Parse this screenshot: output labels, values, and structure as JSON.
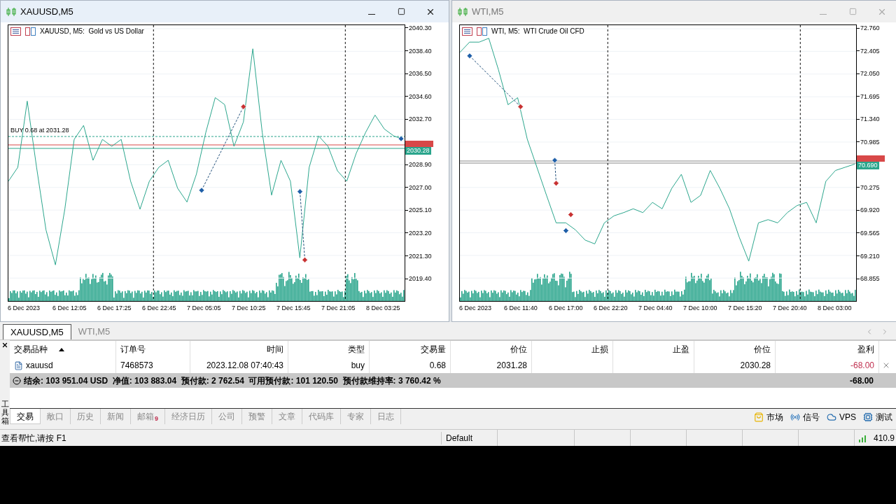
{
  "windows": [
    {
      "title": "XAUUSD,M5",
      "active": true,
      "legend": "XAUUSD, M5:  Gold vs US Dollar",
      "time_labels": [
        "6 Dec 2023",
        "6 Dec 12:05",
        "6 Dec 17:25",
        "6 Dec 22:45",
        "7 Dec 05:05",
        "7 Dec 10:25",
        "7 Dec 15:45",
        "7 Dec 21:05",
        "8 Dec 03:25"
      ],
      "order_label": "BUY 0.68 at 2031.28",
      "bid_tag": "2030.28",
      "chart_data": {
        "type": "line",
        "grid": true,
        "ylim": [
          2017.48,
          2040.59
        ],
        "yticks": [
          {
            "value": 2040.3,
            "label": "2040.30"
          },
          {
            "value": 2038.4,
            "label": "2038.40"
          },
          {
            "value": 2036.5,
            "label": "2036.50"
          },
          {
            "value": 2034.6,
            "label": "2034.60"
          },
          {
            "value": 2032.7,
            "label": "2032.70"
          },
          {
            "value": 2028.9,
            "label": "2028.90"
          },
          {
            "value": 2027,
            "label": "2027.00"
          },
          {
            "value": 2025.1,
            "label": "2025.10"
          },
          {
            "value": 2023.2,
            "label": "2023.20"
          },
          {
            "value": 2021.3,
            "label": "2021.30"
          },
          {
            "value": 2019.4,
            "label": "2019.40"
          }
        ],
        "series": [
          {
            "color": "#2aa58c",
            "values": [
              2027.52,
              2028.68,
              2034.23,
              2028.68,
              2023.43,
              2020.51,
              2025.18,
              2031.02,
              2032.19,
              2029.27,
              2031.02,
              2030.44,
              2031.02,
              2027.52,
              2025.18,
              2027.52,
              2028.68,
              2029.27,
              2026.93,
              2025.77,
              2028.1,
              2031.6,
              2034.52,
              2033.94,
              2030.44,
              2032.48,
              2038.61,
              2031.6,
              2026.35,
              2029.27,
              2027.52,
              2021.1,
              2028.68,
              2031.31,
              2030.44,
              2028.39,
              2027.52,
              2029.85,
              2031.6,
              2033.06,
              2031.89,
              2031.31,
              2031.02
            ]
          }
        ]
      }
    },
    {
      "title": "WTI,M5",
      "active": false,
      "legend": "WTI, M5:  WTI Crude Oil CFD",
      "time_labels": [
        "6 Dec 2023",
        "6 Dec 11:40",
        "6 Dec 17:00",
        "6 Dec 22:20",
        "7 Dec 04:40",
        "7 Dec 10:00",
        "7 Dec 15:20",
        "7 Dec 20:40",
        "8 Dec 03:00"
      ],
      "bid_tag": "70.690",
      "chart_data": {
        "type": "line",
        "grid": true,
        "ylim": [
          68.496,
          72.815
        ],
        "yticks": [
          {
            "value": 72.76,
            "label": "72.760"
          },
          {
            "value": 72.405,
            "label": "72.405"
          },
          {
            "value": 72.05,
            "label": "72.050"
          },
          {
            "value": 71.695,
            "label": "71.695"
          },
          {
            "value": 71.34,
            "label": "71.340"
          },
          {
            "value": 70.985,
            "label": "70.985"
          },
          {
            "value": 70.275,
            "label": "70.275"
          },
          {
            "value": 69.92,
            "label": "69.920"
          },
          {
            "value": 69.565,
            "label": "69.565"
          },
          {
            "value": 69.21,
            "label": "69.210"
          },
          {
            "value": 68.855,
            "label": "68.855"
          }
        ],
        "series": [
          {
            "color": "#2aa58c",
            "values": [
              72.39,
              72.55,
              72.55,
              72.61,
              72.12,
              71.57,
              71.68,
              71.03,
              70.59,
              70.15,
              69.72,
              69.72,
              69.61,
              69.45,
              69.39,
              69.72,
              69.83,
              69.88,
              69.94,
              69.88,
              70.04,
              69.94,
              70.26,
              70.48,
              70.04,
              70.15,
              70.54,
              70.26,
              69.94,
              69.5,
              69.12,
              69.72,
              69.77,
              69.72,
              69.88,
              69.99,
              70.04,
              69.72,
              70.37,
              70.54,
              70.59,
              70.64
            ]
          }
        ]
      }
    }
  ],
  "chart_tabs": [
    {
      "label": "XAUUSD,M5",
      "selected": true
    },
    {
      "label": "WTI,M5",
      "selected": false
    }
  ],
  "toolbox": {
    "title": "工具箱",
    "columns": [
      {
        "label": "交易品种",
        "sorted": true
      },
      {
        "label": "订单号",
        "sorted": false
      },
      {
        "label": "时间",
        "sorted": false
      },
      {
        "label": "类型",
        "sorted": false
      },
      {
        "label": "交易量",
        "sorted": false
      },
      {
        "label": "价位",
        "sorted": false
      },
      {
        "label": "止损",
        "sorted": false
      },
      {
        "label": "止盈",
        "sorted": false
      },
      {
        "label": "价位",
        "sorted": false
      },
      {
        "label": "盈利",
        "sorted": false
      }
    ],
    "rows": [
      {
        "cells": [
          "xauusd",
          "7468573",
          "2023.12.08 07:40:43",
          "buy",
          "0.68",
          "2031.28",
          null,
          null,
          "2030.28",
          "-68.00"
        ],
        "loss": true
      }
    ],
    "summary": "结余: 103 951.04 USD  净值: 103 883.04  预付款: 2 762.54  可用预付款: 101 120.50  预付款维持率: 3 760.42 %",
    "summary_total": "-68.00",
    "tabs": [
      {
        "label": "交易",
        "selected": true
      },
      {
        "label": "敞口",
        "selected": false
      },
      {
        "label": "历史",
        "selected": false
      },
      {
        "label": "新闻",
        "selected": false
      },
      {
        "label": "邮箱",
        "selected": false,
        "badge": "9"
      },
      {
        "label": "经济日历",
        "selected": false
      },
      {
        "label": "公司",
        "selected": false
      },
      {
        "label": "预警",
        "selected": false
      },
      {
        "label": "文章",
        "selected": false
      },
      {
        "label": "代码库",
        "selected": false
      },
      {
        "label": "专家",
        "selected": false
      },
      {
        "label": "日志",
        "selected": false
      }
    ],
    "links": [
      {
        "kind": "market",
        "label": "市场"
      },
      {
        "kind": "signals",
        "label": "信号"
      },
      {
        "kind": "vps",
        "label": "VPS"
      },
      {
        "kind": "tester",
        "label": "测试"
      }
    ]
  },
  "status_bar": {
    "help": "查看帮忙,请按 F1",
    "profile": "Default",
    "ping": "410.9"
  }
}
